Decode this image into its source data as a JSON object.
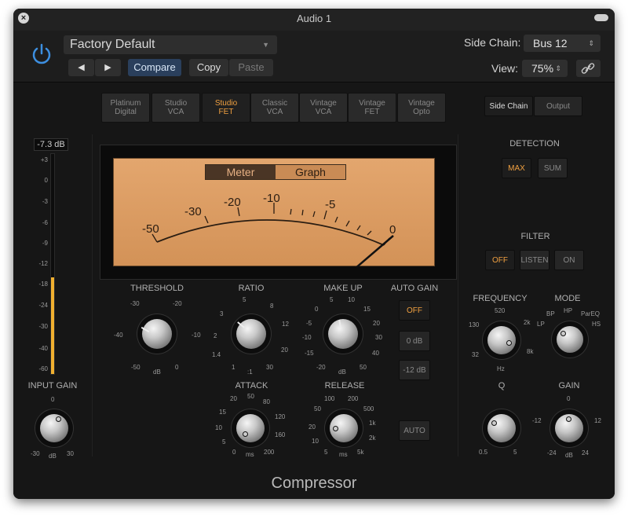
{
  "window": {
    "title": "Audio 1"
  },
  "header": {
    "preset": "Factory Default",
    "prev_label": "◀",
    "next_label": "▶",
    "compare": "Compare",
    "copy": "Copy",
    "paste": "Paste",
    "sidechain_label": "Side Chain:",
    "sidechain_value": "Bus 12",
    "view_label": "View:",
    "view_value": "75%",
    "link_icon": "link-icon"
  },
  "models": [
    {
      "label": "Platinum\nDigital",
      "active": false
    },
    {
      "label": "Studio\nVCA",
      "active": false
    },
    {
      "label": "Studio\nFET",
      "active": true
    },
    {
      "label": "Classic\nVCA",
      "active": false
    },
    {
      "label": "Vintage\nVCA",
      "active": false
    },
    {
      "label": "Vintage\nFET",
      "active": false
    },
    {
      "label": "Vintage\nOpto",
      "active": false
    }
  ],
  "input_meter": {
    "readout": "-7.3 dB",
    "scale": [
      "+3",
      "0",
      "-3",
      "-6",
      "-9",
      "-12",
      "-18",
      "-24",
      "-30",
      "-40",
      "-60"
    ],
    "level_fraction": 0.44
  },
  "meter": {
    "mode_meter": "Meter",
    "mode_graph": "Graph",
    "labels": [
      "-50",
      "-30",
      "-20",
      "-10",
      "-5",
      "0"
    ]
  },
  "threshold": {
    "label": "THRESHOLD",
    "scale": [
      "-30",
      "-20",
      "-40",
      "-10",
      "-50",
      "0"
    ],
    "unit": "dB"
  },
  "ratio": {
    "label": "RATIO",
    "scale": [
      "5",
      "8",
      "3",
      "12",
      "2",
      "20",
      "1.4",
      "30",
      "1"
    ],
    "unit": ":1"
  },
  "makeup": {
    "label": "MAKE UP",
    "scale": [
      "5",
      "10",
      "0",
      "15",
      "-5",
      "20",
      "-10",
      "30",
      "-15",
      "40",
      "-20",
      "50"
    ],
    "unit": "dB"
  },
  "autogain": {
    "label": "AUTO GAIN",
    "off": "OFF",
    "zero": "0 dB",
    "minus12": "-12 dB"
  },
  "attack": {
    "label": "ATTACK",
    "scale": [
      "20",
      "50",
      "15",
      "80",
      "10",
      "120",
      "5",
      "160",
      "0",
      "200"
    ],
    "unit": "ms"
  },
  "release": {
    "label": "RELEASE",
    "scale": [
      "100",
      "200",
      "50",
      "500",
      "20",
      "1k",
      "10",
      "2k",
      "5",
      "5k"
    ],
    "unit": "ms"
  },
  "auto_btn": "AUTO",
  "input_gain": {
    "label": "INPUT GAIN",
    "top": "0",
    "left": "-30",
    "right": "30",
    "unit": "dB"
  },
  "sidechain_tabs": {
    "side_chain": "Side Chain",
    "output": "Output"
  },
  "detection": {
    "label": "DETECTION",
    "max": "MAX",
    "sum": "SUM"
  },
  "filter": {
    "label": "FILTER",
    "off": "OFF",
    "listen": "LISTEN",
    "on": "ON"
  },
  "frequency": {
    "label": "FREQUENCY",
    "scale": [
      "520",
      "130",
      "2k",
      "32",
      "8k"
    ],
    "unit": "Hz"
  },
  "mode": {
    "label": "MODE",
    "scale": [
      "BP",
      "HP",
      "LP",
      "ParEQ",
      "HS"
    ]
  },
  "q": {
    "label": "Q",
    "left": "0.5",
    "right": "5"
  },
  "gain": {
    "label": "GAIN",
    "top": "0",
    "left": "-12",
    "right": "12",
    "bl": "-24",
    "br": "24",
    "unit": "dB"
  },
  "plugin_name": "Compressor",
  "colors": {
    "accent": "#f0a040",
    "meter_face": "#d9995e",
    "blue": "#3d8fe0"
  }
}
